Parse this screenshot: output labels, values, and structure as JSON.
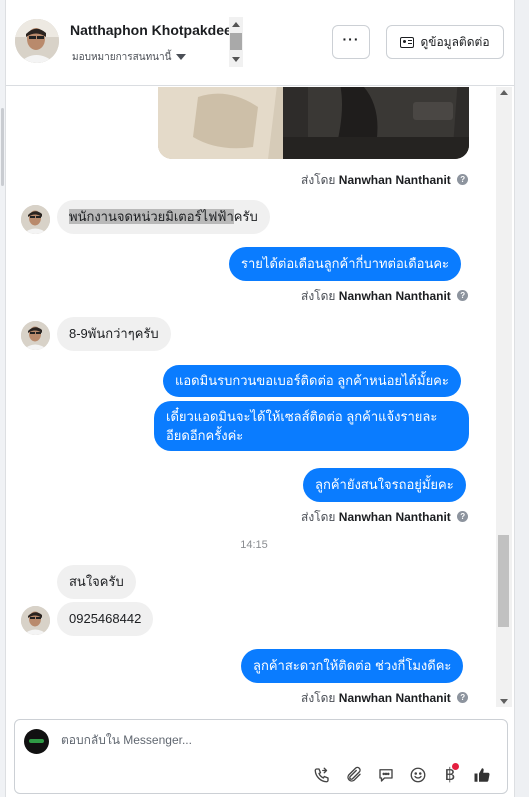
{
  "header": {
    "contact_name": "Natthaphon Khotpakdee",
    "assign_label": "มอบหมายการสนทนานี้",
    "more_label": "···",
    "view_contact_label": "ดูข้อมูลติดต่อ"
  },
  "messages": {
    "sent_by_prefix": "ส่งโดย",
    "agent_name": "Nanwhan Nanthanit",
    "m1_hl": "พนักงานจดหน่วยมิเตอร์ไฟฟ้า",
    "m1_rest": "ครับ",
    "m2": "รายได้ต่อเดือนลูกค้ากี่บาทต่อเดือนคะ",
    "m3": "8-9พันกว่าๆครับ",
    "m4": "แอดมินรบกวนขอเบอร์ติดต่อ ลูกค้าหน่อยได้มั้ยคะ",
    "m5": "เดี๋ยวแอดมินจะได้ให้เซลส์ติดต่อ ลูกค้าแจ้งรายละ อียดอีกครั้งค่ะ",
    "m6": "ลูกค้ายังสนใจรถอยู่มั้ยคะ",
    "time": "14:15",
    "m7": "สนใจครับ",
    "m8": "0925468442",
    "m9": "ลูกค้าสะดวกให้ติดต่อ ช่วงกี่โมงดีคะ"
  },
  "composer": {
    "placeholder": "ตอบกลับใน Messenger...",
    "tool_icons": [
      "phone-icon",
      "attachment-icon",
      "saved-reply-icon",
      "emoji-icon",
      "baht-payment-icon",
      "thumbs-up-icon"
    ],
    "baht_symbol": "฿"
  },
  "colors": {
    "outgoing_bubble": "#0a7cff",
    "incoming_bubble": "#f0f0f0",
    "notification_dot": "#e41e3f"
  }
}
